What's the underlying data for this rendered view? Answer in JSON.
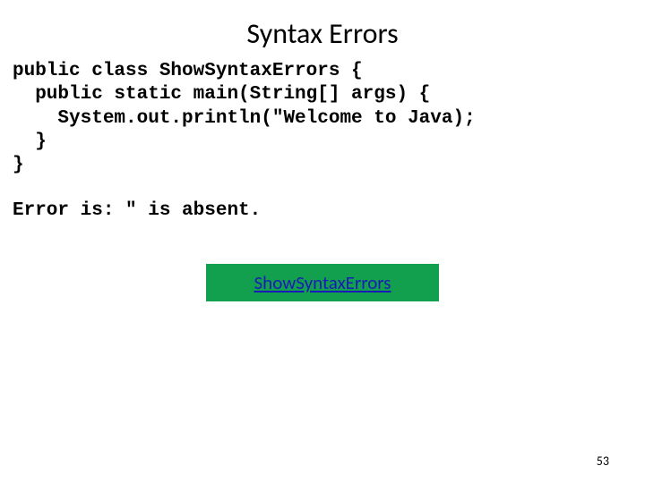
{
  "slide": {
    "title": "Syntax Errors",
    "code": "public class ShowSyntaxErrors {\n  public static main(String[] args) {\n    System.out.println(\"Welcome to Java);\n  }\n}",
    "error_message": "Error is: \" is absent.",
    "button_label": "ShowSyntaxErrors",
    "page_number": "53"
  }
}
